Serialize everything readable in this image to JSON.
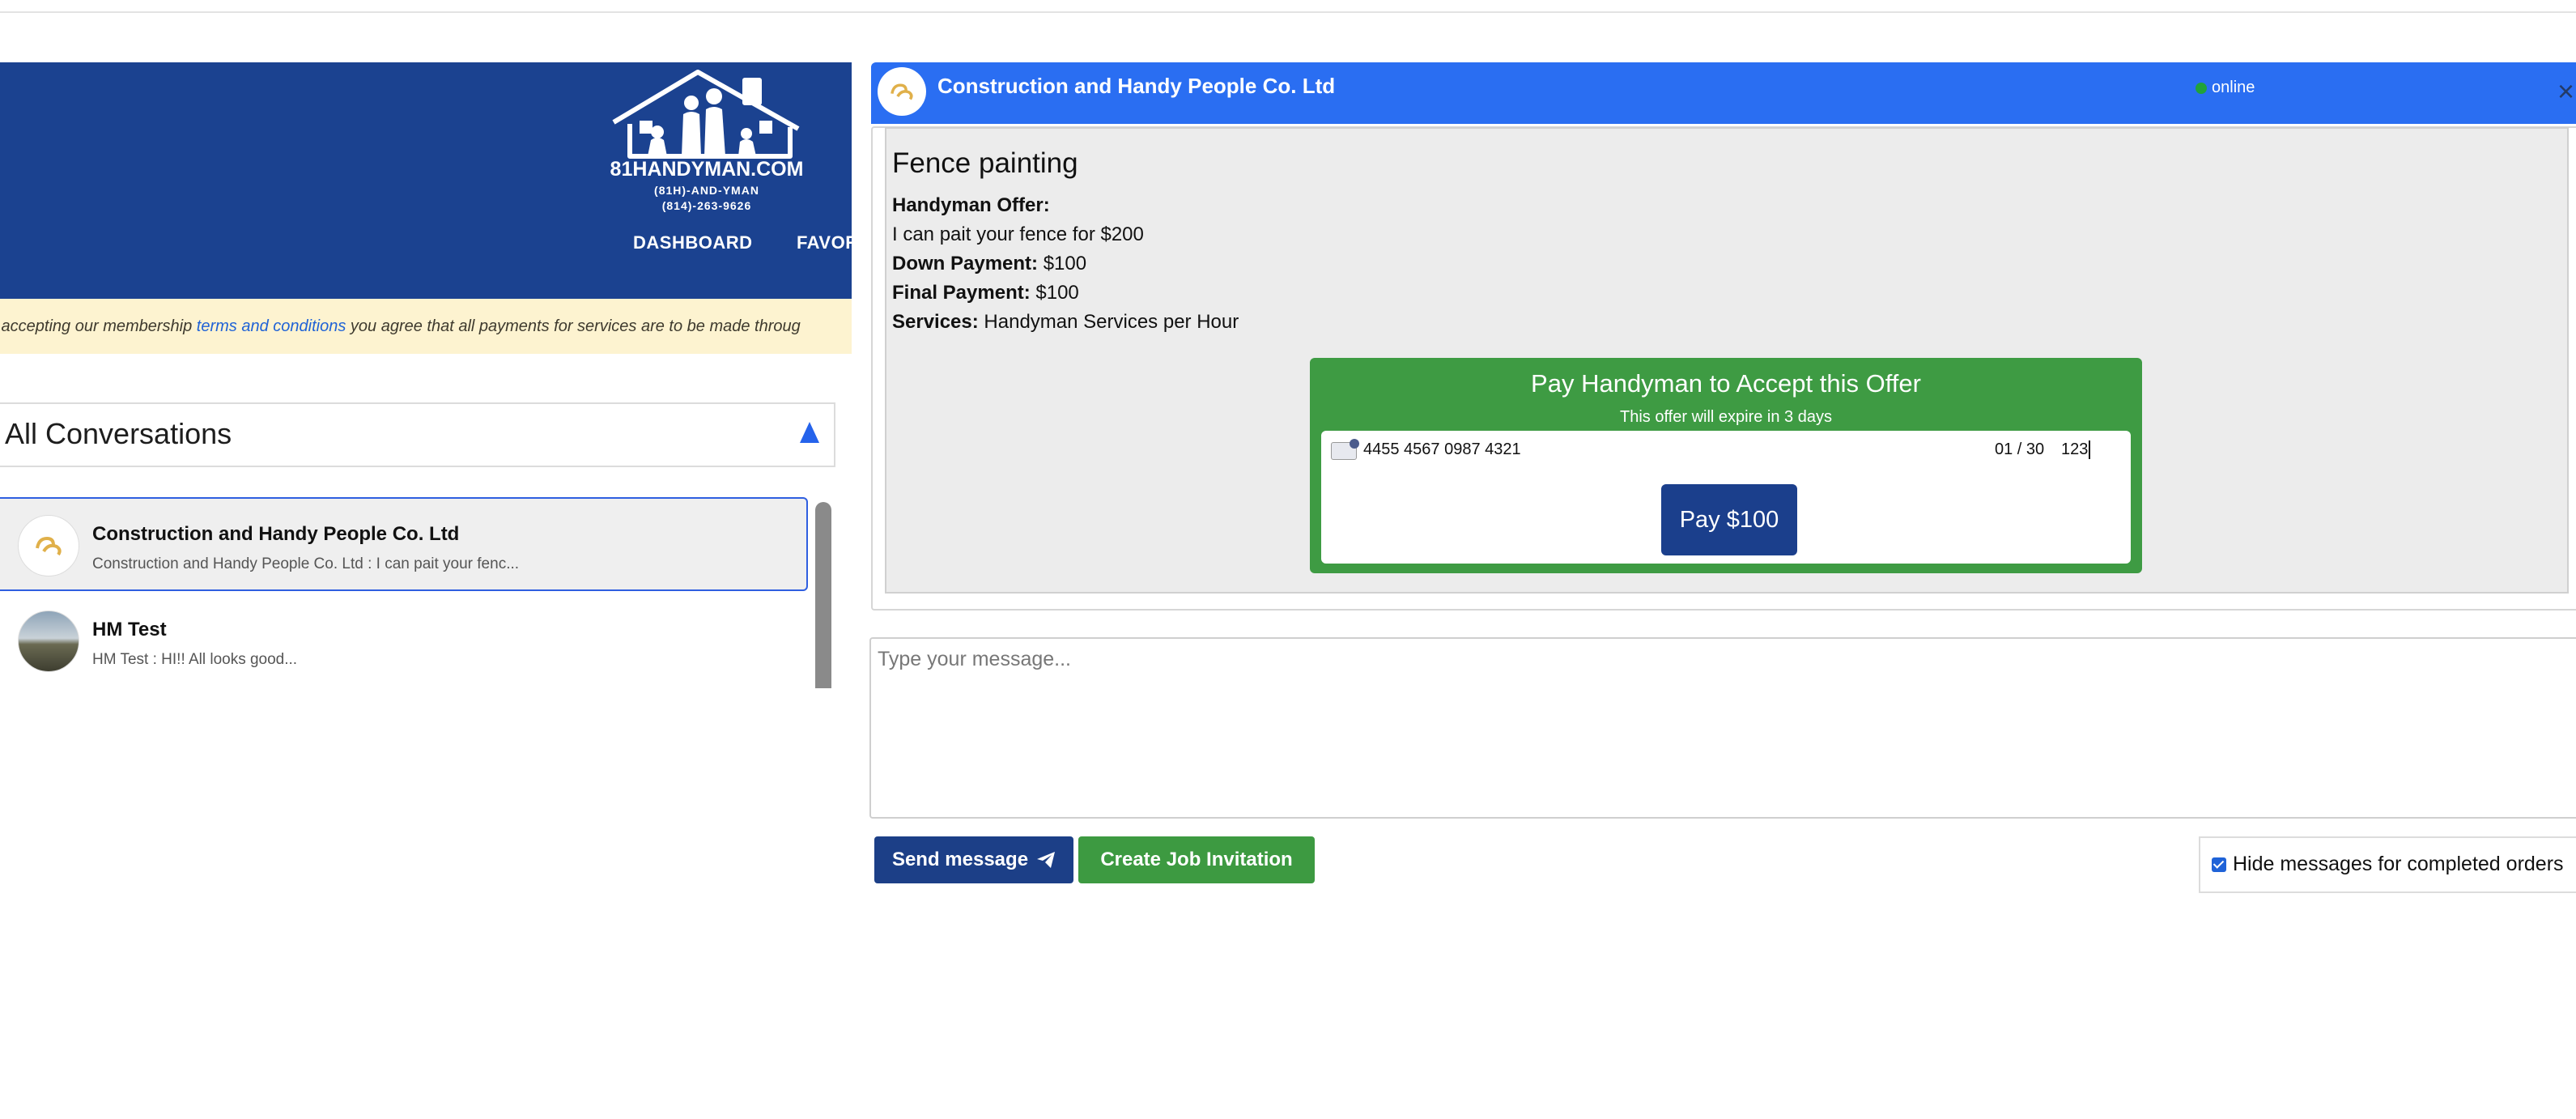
{
  "brand": {
    "name": "81HANDYMAN.COM",
    "tagline": "(81H)-AND-YMAN",
    "phone": "(814)-263-9626",
    "header_color": "#1b4290"
  },
  "nav": {
    "items": [
      "DASHBOARD",
      "FAVORIT"
    ]
  },
  "notice": {
    "prefix": "y accepting our membership ",
    "link": "terms and conditions",
    "suffix": " you agree that all payments for services are to be made throug"
  },
  "conversations": {
    "title": "All Conversations",
    "items": [
      {
        "name": "Construction and Handy People Co. Ltd",
        "preview": "Construction and Handy People Co. Ltd : I can pait your fenc...",
        "active": true
      },
      {
        "name": "HM Test",
        "preview": "HM Test : HI!! All looks good...",
        "active": false
      }
    ]
  },
  "chat": {
    "name": "Construction and Handy People Co. Ltd",
    "status": "online",
    "header_color": "#2a6ef2",
    "close_icon": "close-icon"
  },
  "offer": {
    "title": "Fence painting",
    "offer_label": "Handyman Offer:",
    "offer_text": "I can pait your fence for $200",
    "down_label": "Down Payment:",
    "down_value": "$100",
    "final_label": "Final Payment:",
    "final_value": "$100",
    "services_label": "Services:",
    "services_value": "Handyman Services per Hour"
  },
  "payment": {
    "title": "Pay Handyman to Accept this Offer",
    "expiry": "This offer will expire in 3 days",
    "card_number": "4455 4567 0987 4321",
    "card_exp": "01 / 30",
    "card_cvc": "123",
    "button": "Pay $100",
    "box_color": "#3e9b43"
  },
  "composer": {
    "placeholder": "Type your message...",
    "send_label": "Send message",
    "job_label": "Create Job Invitation",
    "hide_label": "Hide messages for completed orders",
    "hide_checked": true
  }
}
